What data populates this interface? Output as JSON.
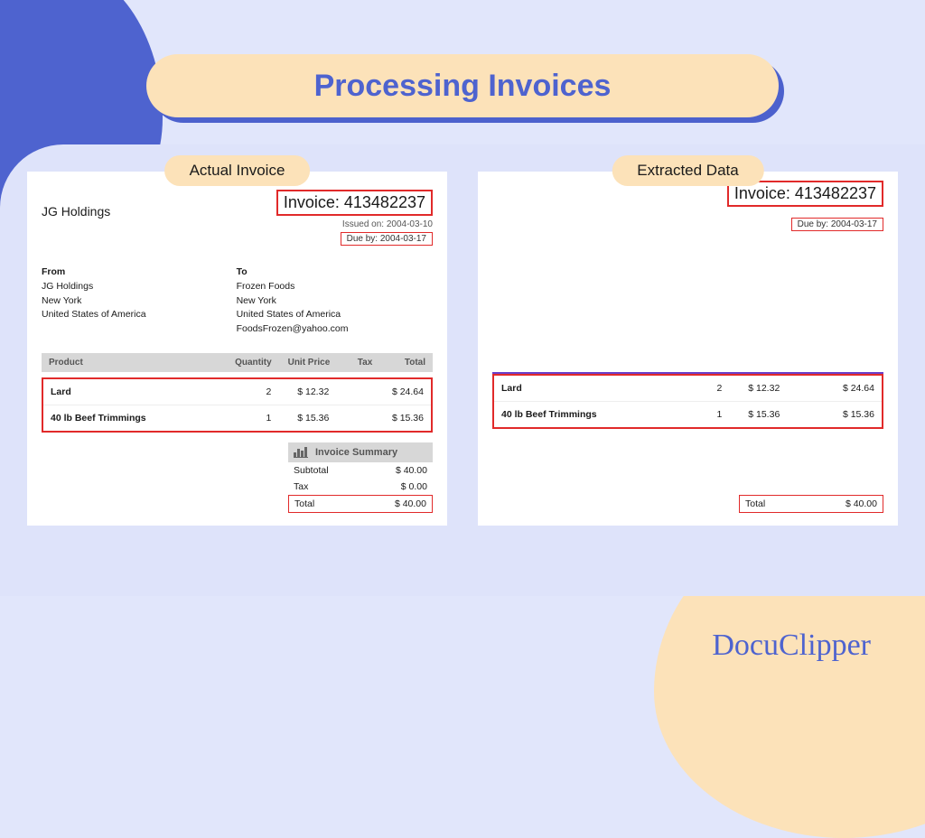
{
  "title": "Processing Invoices",
  "brand": "DocuClipper",
  "left": {
    "label": "Actual Invoice",
    "company": "JG Holdings",
    "invoice_label": "Invoice:",
    "invoice_number": "413482237",
    "issued": "Issued on: 2004-03-10",
    "due": "Due by: 2004-03-17",
    "from_hdr": "From",
    "from_lines": [
      "JG Holdings",
      "New York",
      "United States of America"
    ],
    "to_hdr": "To",
    "to_lines": [
      "Frozen Foods",
      "New York",
      "United States of America",
      "FoodsFrozen@yahoo.com"
    ],
    "columns": {
      "product": "Product",
      "qty": "Quantity",
      "unit_price": "Unit Price",
      "tax": "Tax",
      "total": "Total"
    },
    "items": [
      {
        "name": "Lard",
        "qty": "2",
        "unit_price": "$ 12.32",
        "tax": "",
        "total": "$ 24.64"
      },
      {
        "name": "40 lb Beef Trimmings",
        "qty": "1",
        "unit_price": "$ 15.36",
        "tax": "",
        "total": "$ 15.36"
      }
    ],
    "summary": {
      "title": "Invoice Summary",
      "subtotal_label": "Subtotal",
      "subtotal": "$ 40.00",
      "tax_label": "Tax",
      "tax": "$ 0.00",
      "total_label": "Total",
      "total": "$ 40.00"
    }
  },
  "right": {
    "label": "Extracted Data",
    "invoice_label": "Invoice:",
    "invoice_number": "413482237",
    "due": "Due by: 2004-03-17",
    "items": [
      {
        "name": "Lard",
        "qty": "2",
        "unit_price": "$ 12.32",
        "total": "$ 24.64"
      },
      {
        "name": "40 lb Beef Trimmings",
        "qty": "1",
        "unit_price": "$ 15.36",
        "total": "$ 15.36"
      }
    ],
    "total_label": "Total",
    "total": "$ 40.00"
  }
}
